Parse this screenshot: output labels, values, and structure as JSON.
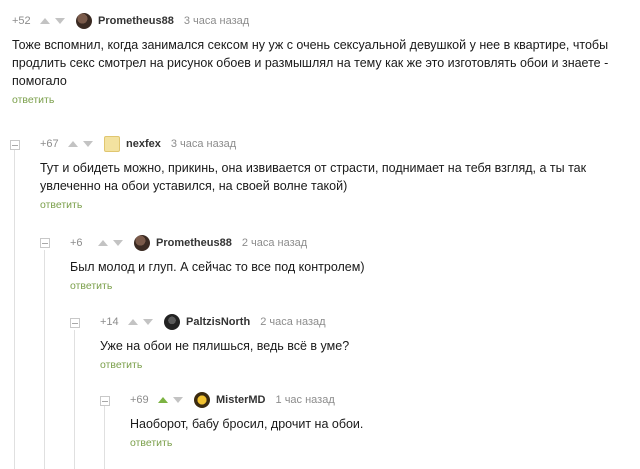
{
  "comments": [
    {
      "rating": "+52",
      "author": "Prometheus88",
      "time": "3 часа назад",
      "text": "Тоже вспомнил, когда занимался сексом ну уж с очень сексуальной девушкой у нее в квартире, чтобы продлить секс смотрел на рисунок обоев и размышлял на тему как же это изготовлять обои и знаете - помогало",
      "reply": "ответить"
    },
    {
      "rating": "+67",
      "author": "nexfex",
      "time": "3 часа назад",
      "text": "Тут и обидеть можно, прикинь, она извивается от страсти, поднимает на тебя взгляд, а ты так увлеченно на обои уставился, на своей волне такой)",
      "reply": "ответить"
    },
    {
      "rating": "+6",
      "author": "Prometheus88",
      "time": "2 часа назад",
      "text": "Был молод и глуп. А сейчас то все под контролем)",
      "reply": "ответить"
    },
    {
      "rating": "+14",
      "author": "PaltzisNorth",
      "time": "2 часа назад",
      "text": "Уже на обои не пялишься, ведь всё в уме?",
      "reply": "ответить"
    },
    {
      "rating": "+69",
      "author": "MisterMD",
      "time": "1 час назад",
      "text": "Наоборот, бабу бросил, дрочит на обои.",
      "reply": "ответить"
    }
  ],
  "colors": {
    "reply_link": "#7a9f4a",
    "upvote_active": "#7cb342",
    "muted": "#8c8c8c"
  }
}
